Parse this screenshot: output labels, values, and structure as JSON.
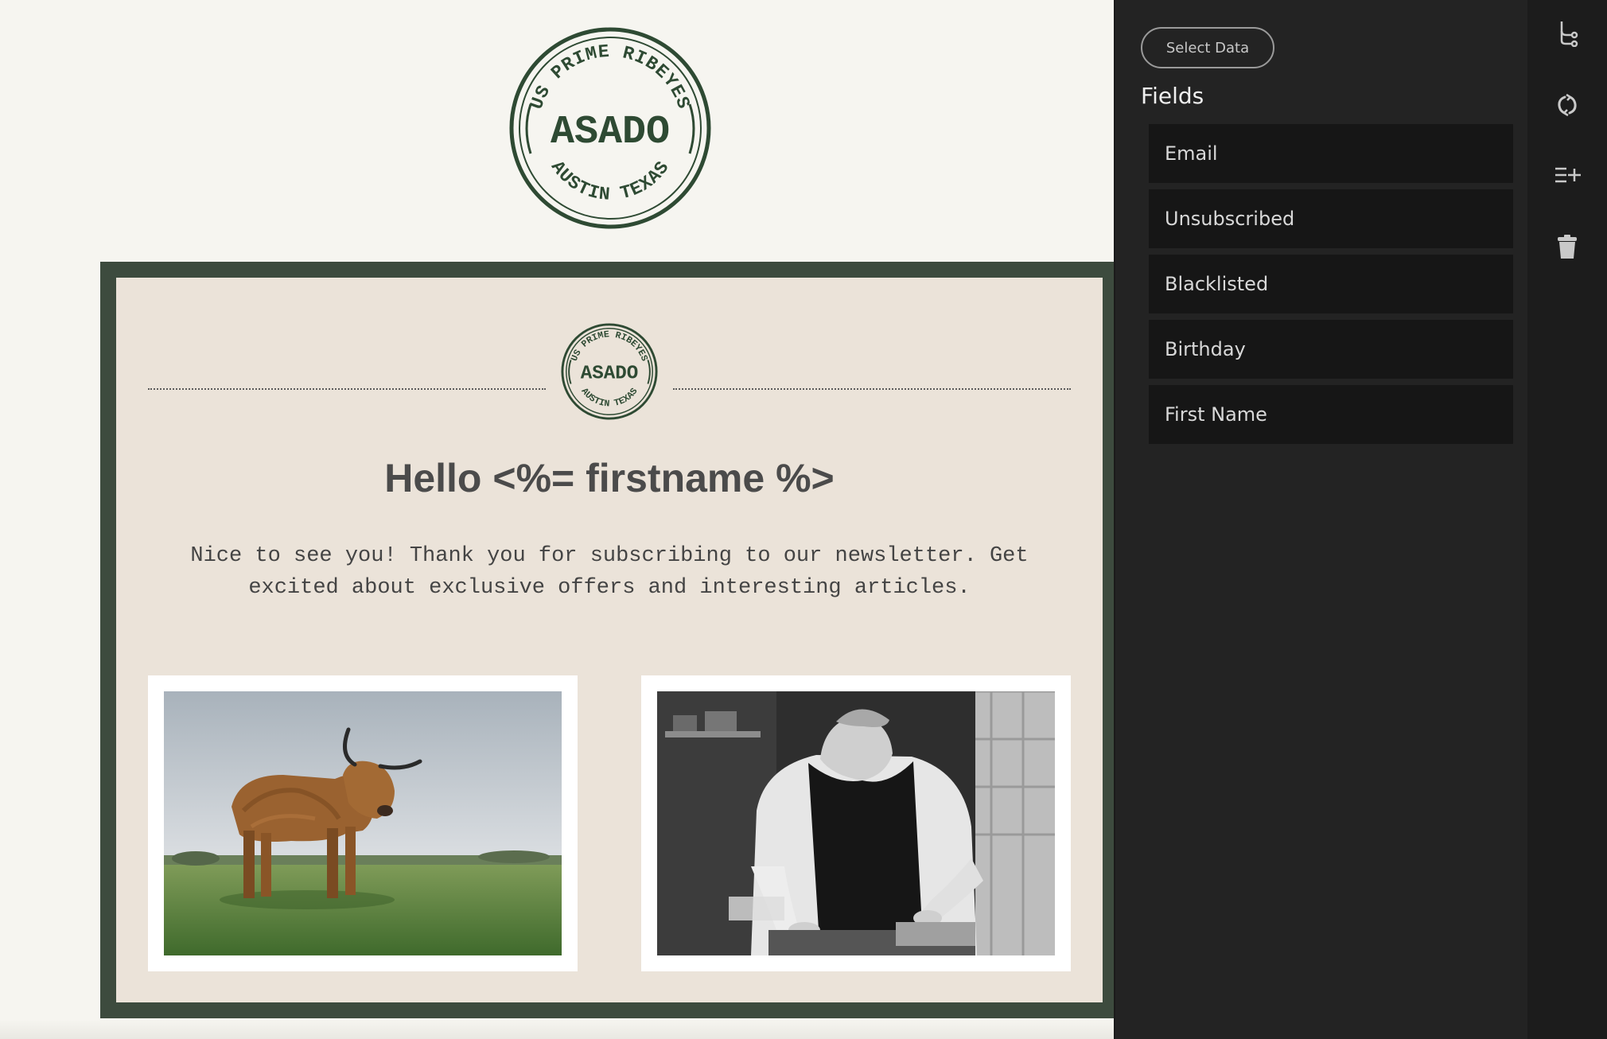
{
  "top_logo": {
    "arc_top": "US PRIME RIBEYES",
    "center": "ASADO",
    "arc_bottom": "AUSTIN TEXAS"
  },
  "email": {
    "greeting": "Hello <%= firstname %>",
    "intro": "Nice to see you! Thank you for subscribing to our newsletter. Get excited about exclusive offers and interesting articles."
  },
  "panel": {
    "select_button": "Select Data",
    "fields_title": "Fields",
    "fields": [
      {
        "label": "Email"
      },
      {
        "label": "Unsubscribed"
      },
      {
        "label": "Blacklisted"
      },
      {
        "label": "Birthday"
      },
      {
        "label": "First Name"
      }
    ]
  },
  "toolbar": {
    "icons": [
      "branch-icon",
      "refresh-icon",
      "add-list-icon",
      "trash-icon"
    ]
  },
  "colors": {
    "frame": "#3d4b3e",
    "email_bg": "#ebe3d9",
    "stamp_green": "#2e4a33",
    "panel_bg": "#232323",
    "field_bg": "#161616"
  }
}
